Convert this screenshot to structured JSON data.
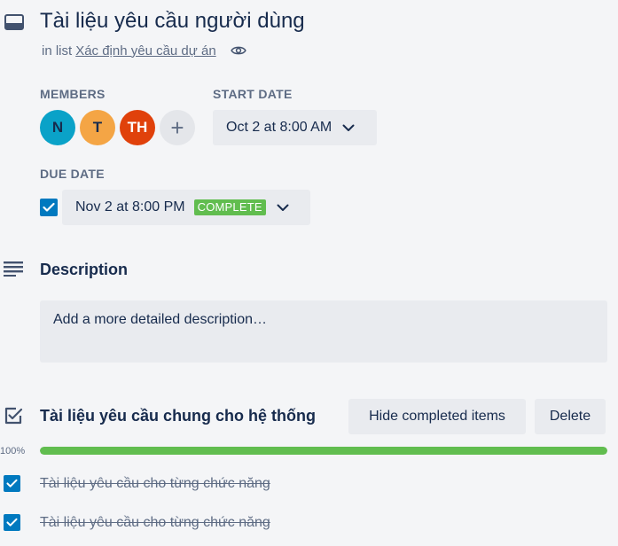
{
  "card": {
    "title": "Tài liệu yêu cầu người dùng",
    "in_list_prefix": "in list",
    "list_name": "Xác định yêu cầu dự án"
  },
  "members": {
    "label": "MEMBERS",
    "avatars": [
      {
        "initials": "N",
        "color": "#0aa2c8"
      },
      {
        "initials": "T",
        "color": "#f4a545"
      },
      {
        "initials": "TH",
        "color": "#e0410b"
      }
    ],
    "add_symbol": "+"
  },
  "start_date": {
    "label": "START DATE",
    "value": "Oct 2 at 8:00 AM"
  },
  "due_date": {
    "label": "DUE DATE",
    "checked": true,
    "value": "Nov 2 at 8:00 PM",
    "status": "COMPLETE"
  },
  "description": {
    "title": "Description",
    "placeholder": "Add a more detailed description…"
  },
  "checklist": {
    "title": "Tài liệu yêu cầu chung cho hệ thống",
    "hide_label": "Hide completed items",
    "delete_label": "Delete",
    "progress_label": "100%",
    "progress": 1.0,
    "items": [
      {
        "text": "Tài liệu yêu cầu cho từng chức năng",
        "checked": true
      },
      {
        "text": "Tài liệu yêu cầu cho từng chức năng",
        "checked": true
      }
    ]
  },
  "icons": {
    "card": "card-icon",
    "eye": "eye-icon",
    "chevron": "chevron-down-icon",
    "check": "checkmark-icon",
    "description": "description-lines-icon",
    "checklist": "checklist-icon"
  },
  "colors": {
    "accent": "#0079bf",
    "complete": "#61bd4f",
    "background": "#f4f5f7"
  }
}
